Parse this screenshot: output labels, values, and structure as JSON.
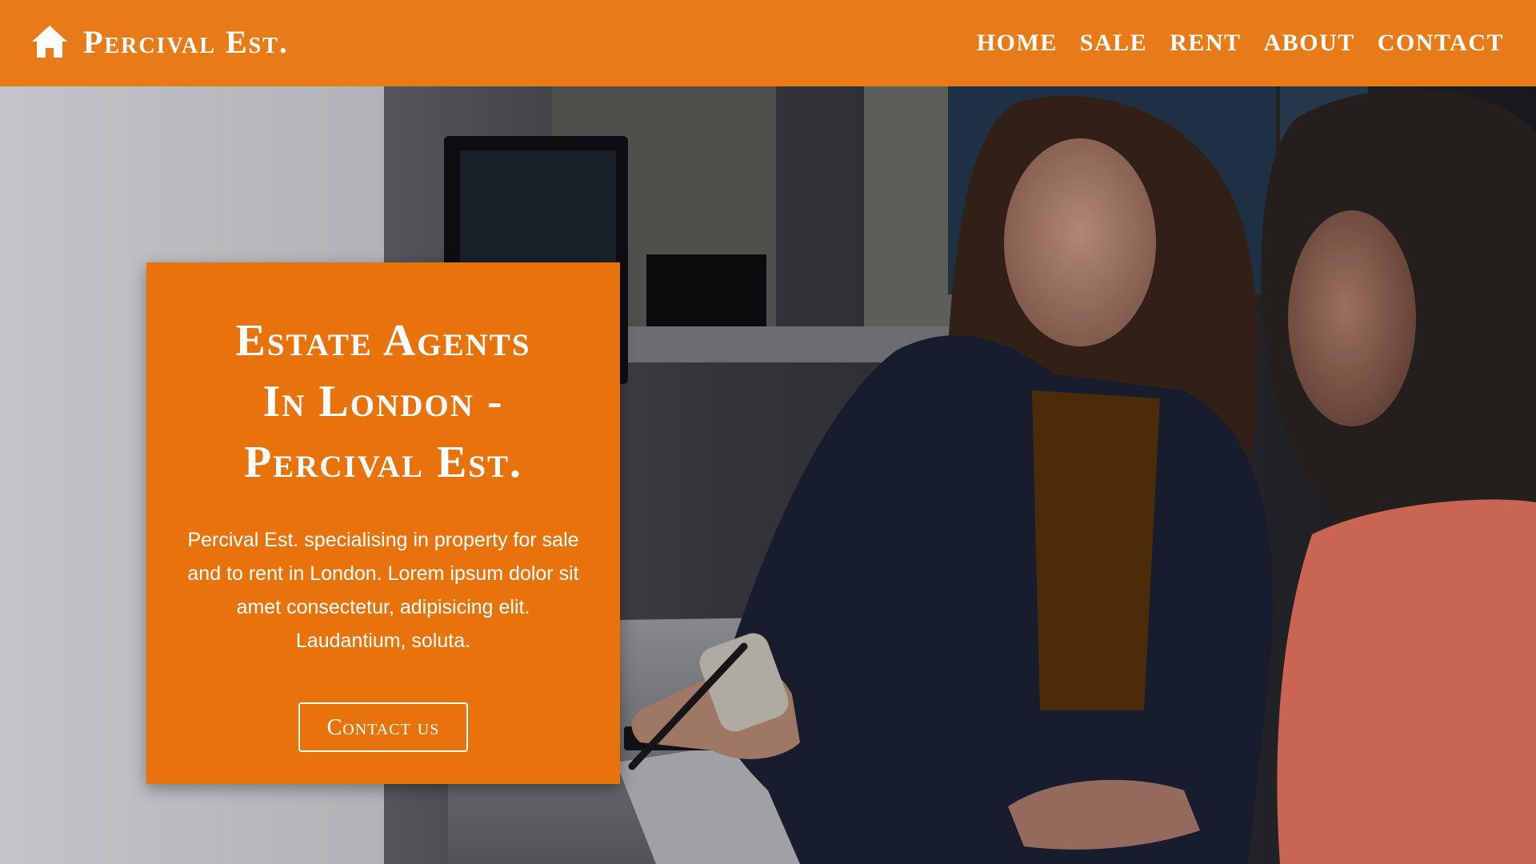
{
  "brand": {
    "name": "Percival Est.",
    "icon": "home-icon"
  },
  "nav": {
    "items": [
      {
        "label": "HOME"
      },
      {
        "label": "SALE"
      },
      {
        "label": "RENT"
      },
      {
        "label": "ABOUT"
      },
      {
        "label": "CONTACT"
      }
    ]
  },
  "hero": {
    "title_lines": [
      "Estate Agents",
      "In London -",
      "Percival Est."
    ],
    "description": "Percival Est. specialising in property for sale and to rent in London. Lorem ipsum dolor sit amet consectetur, adipisicing elit. Laudantium, soluta.",
    "button_label": "Contact us"
  },
  "colors": {
    "navbar": "#e87b18",
    "card": "#e8720c",
    "text": "#ffffff"
  }
}
